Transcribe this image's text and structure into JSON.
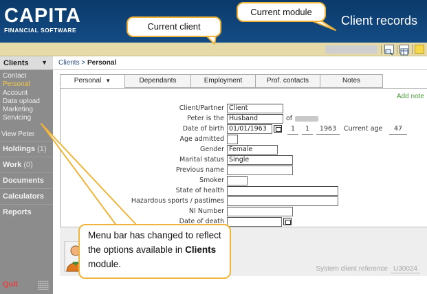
{
  "header": {
    "logo_main": "CAPITA",
    "logo_sub": "FINANCIAL SOFTWARE",
    "module_title": "Client records"
  },
  "sidebar": {
    "module_selector": "Clients",
    "sub_items": [
      "Contact",
      "Personal",
      "Account",
      "Data upload",
      "Marketing",
      "Servicing"
    ],
    "active_sub_item": "Personal",
    "view_link": "View Peter",
    "sections": [
      {
        "label": "Holdings",
        "count": "(1)"
      },
      {
        "label": "Work",
        "count": "(0)"
      },
      {
        "label": "Documents",
        "count": ""
      },
      {
        "label": "Calculators",
        "count": ""
      },
      {
        "label": "Reports",
        "count": ""
      }
    ],
    "quit": "Quit"
  },
  "breadcrumb": {
    "parent": "Clients",
    "separator": ">",
    "current": "Personal"
  },
  "tabs": [
    "Personal",
    "Dependants",
    "Employment",
    "Prof. contacts",
    "Notes"
  ],
  "active_tab": "Personal",
  "add_note": "Add note",
  "form": {
    "client_partner": {
      "label": "Client/Partner",
      "value": "Client"
    },
    "relation": {
      "label": "Peter is the",
      "value": "Husband",
      "of_text": "of"
    },
    "dob": {
      "label": "Date of birth",
      "value": "01/01/1963",
      "day": "1",
      "month": "1",
      "year": "1963",
      "age_label": "Current age",
      "age_value": "47"
    },
    "age_admitted": {
      "label": "Age admitted",
      "value": ""
    },
    "gender": {
      "label": "Gender",
      "value": "Female"
    },
    "marital_status": {
      "label": "Marital status",
      "value": "Single"
    },
    "previous_name": {
      "label": "Previous name",
      "value": ""
    },
    "smoker": {
      "label": "Smoker",
      "value": ""
    },
    "state_of_health": {
      "label": "State of health",
      "value": ""
    },
    "hazardous": {
      "label": "Hazardous sports / pastimes",
      "value": ""
    },
    "ni_number": {
      "label": "NI Number",
      "value": ""
    },
    "date_of_death": {
      "label": "Date of death",
      "value": ""
    }
  },
  "system_ref": {
    "label": "System client reference",
    "value": "U30024"
  },
  "annotations": {
    "current_module": "Current module",
    "current_client": "Current client",
    "menu_note_line1": "Menu bar has changed to reflect",
    "menu_note_line2": "the options available in",
    "menu_note_bold": "Clients",
    "menu_note_line3": "module."
  },
  "colors": {
    "header_bg": "#144c85",
    "toolbar_bg": "#e6dba8",
    "sidebar_bg": "#8c8c8c",
    "active_sub_item": "#f3c84a",
    "quit": "#e04343",
    "callout_border": "#f0b43a",
    "add_note": "#4a9a3a"
  }
}
